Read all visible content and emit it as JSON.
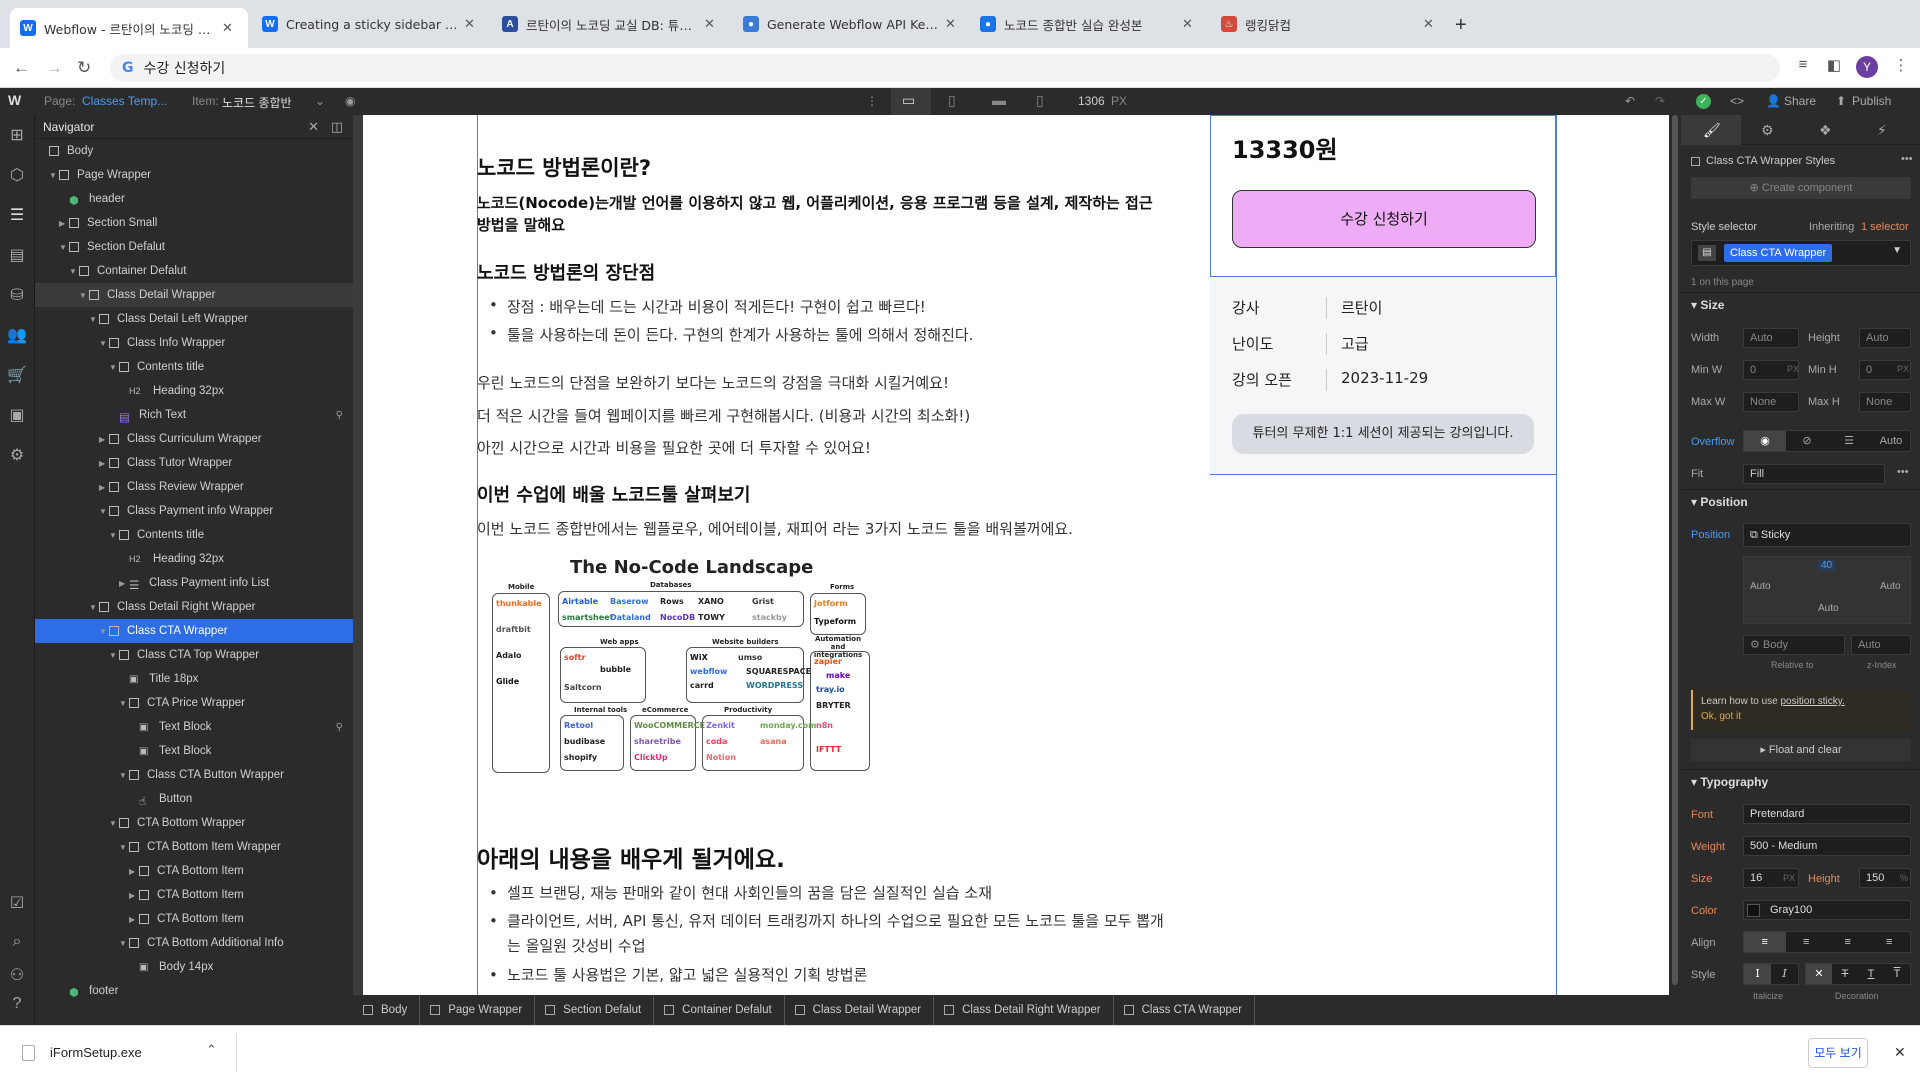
{
  "browser": {
    "tabs": [
      {
        "title": "Webflow - 르탄이의 노코딩 교실 C",
        "fav": "W",
        "color": "#146ef5",
        "active": true
      },
      {
        "title": "Creating a sticky sidebar | Web",
        "fav": "W",
        "color": "#146ef5",
        "active": false
      },
      {
        "title": "르탄이의 노코딩 교실 DB: 튜터 - Ai",
        "fav": "A",
        "color": "#2d4e9e",
        "active": false
      },
      {
        "title": "Generate Webflow API Key | N",
        "fav": "●",
        "color": "#3a7bd5",
        "active": false
      },
      {
        "title": "노코드 종합반 실습 완성본",
        "fav": "●",
        "color": "#1a73e8",
        "active": false
      },
      {
        "title": "랭킹닭컴",
        "fav": "♨",
        "color": "#d34a3a",
        "active": false
      }
    ],
    "new_tab": "+",
    "address": "수강 신청하기",
    "avatar": "Y",
    "nav_icons": [
      "back-icon",
      "forward-icon",
      "reload-icon"
    ]
  },
  "webflow_bar": {
    "logo": "W",
    "page_label": "Page:",
    "page_value": "Classes Temp...",
    "item_label": "Item:",
    "item_value": "노코드 종합반",
    "width_value": "1306",
    "width_unit": "PX",
    "share": "Share",
    "publish": "Publish"
  },
  "navigator": {
    "title": "Navigator",
    "rows": [
      {
        "label": "Body",
        "indent": 0,
        "arrow": "",
        "icon": "box"
      },
      {
        "label": "Page Wrapper",
        "indent": 1,
        "arrow": "▼",
        "icon": "box"
      },
      {
        "label": "header",
        "indent": 2,
        "arrow": "",
        "icon": "comp"
      },
      {
        "label": "Section Small",
        "indent": 2,
        "arrow": "▶",
        "icon": "sec"
      },
      {
        "label": "Section Defalut",
        "indent": 2,
        "arrow": "▼",
        "icon": "sec"
      },
      {
        "label": "Container Defalut",
        "indent": 3,
        "arrow": "▼",
        "icon": "cont"
      },
      {
        "label": "Class Detail Wrapper",
        "indent": 4,
        "arrow": "▼",
        "icon": "box",
        "hl": true
      },
      {
        "label": "Class Detail Left Wrapper",
        "indent": 5,
        "arrow": "▼",
        "icon": "box"
      },
      {
        "label": "Class Info Wrapper",
        "indent": 6,
        "arrow": "▼",
        "icon": "box"
      },
      {
        "label": "Contents title",
        "indent": 7,
        "arrow": "▼",
        "icon": "box"
      },
      {
        "label": "Heading 32px",
        "indent": 8,
        "arrow": "",
        "icon": "H2"
      },
      {
        "label": "Rich Text",
        "indent": 7,
        "arrow": "",
        "icon": "rt",
        "pin": true
      },
      {
        "label": "Class Curriculum Wrapper",
        "indent": 6,
        "arrow": "▶",
        "icon": "box"
      },
      {
        "label": "Class Tutor Wrapper",
        "indent": 6,
        "arrow": "▶",
        "icon": "box"
      },
      {
        "label": "Class Review Wrapper",
        "indent": 6,
        "arrow": "▶",
        "icon": "box"
      },
      {
        "label": "Class Payment info Wrapper",
        "indent": 6,
        "arrow": "▼",
        "icon": "box"
      },
      {
        "label": "Contents title",
        "indent": 7,
        "arrow": "▼",
        "icon": "box"
      },
      {
        "label": "Heading 32px",
        "indent": 8,
        "arrow": "",
        "icon": "H2"
      },
      {
        "label": "Class Payment info List",
        "indent": 8,
        "arrow": "▶",
        "icon": "list"
      },
      {
        "label": "Class Detail Right Wrapper",
        "indent": 5,
        "arrow": "▼",
        "icon": "box"
      },
      {
        "label": "Class CTA Wrapper",
        "indent": 6,
        "arrow": "▼",
        "icon": "box",
        "sel": true
      },
      {
        "label": "Class CTA Top Wrapper",
        "indent": 7,
        "arrow": "▼",
        "icon": "box"
      },
      {
        "label": "Title 18px",
        "indent": 8,
        "arrow": "",
        "icon": "T"
      },
      {
        "label": "CTA Price Wrapper",
        "indent": 8,
        "arrow": "▼",
        "icon": "box"
      },
      {
        "label": "Text Block",
        "indent": 9,
        "arrow": "",
        "icon": "T",
        "pin": true
      },
      {
        "label": "Text Block",
        "indent": 9,
        "arrow": "",
        "icon": "T"
      },
      {
        "label": "Class CTA Button Wrapper",
        "indent": 8,
        "arrow": "▼",
        "icon": "box"
      },
      {
        "label": "Button",
        "indent": 9,
        "arrow": "",
        "icon": "btn"
      },
      {
        "label": "CTA Bottom Wrapper",
        "indent": 7,
        "arrow": "▼",
        "icon": "box"
      },
      {
        "label": "CTA Bottom Item Wrapper",
        "indent": 8,
        "arrow": "▼",
        "icon": "box"
      },
      {
        "label": "CTA Bottom Item",
        "indent": 9,
        "arrow": "▶",
        "icon": "box"
      },
      {
        "label": "CTA Bottom Item",
        "indent": 9,
        "arrow": "▶",
        "icon": "box"
      },
      {
        "label": "CTA Bottom Item",
        "indent": 9,
        "arrow": "▶",
        "icon": "box"
      },
      {
        "label": "CTA Bottom Additional Info",
        "indent": 8,
        "arrow": "▼",
        "icon": "box"
      },
      {
        "label": "Body 14px",
        "indent": 9,
        "arrow": "",
        "icon": "T"
      },
      {
        "label": "footer",
        "indent": 2,
        "arrow": "",
        "icon": "comp"
      }
    ]
  },
  "page": {
    "h_method": "노코드 방법론이란?",
    "method_desc": "노코드(Nocode)는개발 언어를 이용하지 않고 웹, 어플리케이션, 응용 프로그램 등을 설계, 제작하는 접근 방법을 말해요",
    "h_proscons": "노코드 방법론의 장단점",
    "pros": "장점 : 배우는데 드는 시간과 비용이 적게든다! 구현이 쉽고 빠르다!",
    "cons": "툴을 사용하는데 돈이 든다. 구현의 한계가 사용하는 툴에 의해서 정해진다.",
    "p1": "우린 노코드의 단점을 보완하기 보다는 노코드의 강점을 극대화 시킬거예요!",
    "p2": "더 적은 시간을 들여 웹페이지를 빠르게 구현해봅시다. (비용과 시간의 최소화!)",
    "p3": "아낀 시간으로 시간과 비용을 필요한 곳에 더 투자할 수 있어요!",
    "h_tools": "이번 수업에 배울 노코드툴 살펴보기",
    "tools_desc": "이번 노코드 종합반에서는 웹플로우, 에어테이블, 재피어 라는 3가지 노코드 툴을 배워볼꺼에요.",
    "landscape_title": "The No-Code Landscape",
    "landscape_cats": [
      "Mobile",
      "Databases",
      "Forms",
      "Web apps",
      "Website builders",
      "Automation and integrations",
      "Internal tools",
      "eCommerce",
      "Productivity"
    ],
    "landscape_logos": [
      "thunkable",
      "draftbit",
      "Adalo",
      "Glide",
      "Airtable",
      "Baserow",
      "Rows",
      "XANO",
      "Grist",
      "smartsheet",
      "Dataland",
      "NocoDB",
      "TOWY",
      "stackby",
      "Jotform",
      "Typeform",
      "softr",
      "bubble",
      "Saltcorn",
      "WiX",
      "umso",
      "webflow",
      "carrd",
      "SQUARESPACE",
      "WORDPRESS",
      "zapier",
      "make",
      "tray.io",
      "BRYTER",
      "n8n",
      "IFTTT",
      "Retool",
      "budibase",
      "shopify",
      "WooCOMMERCE",
      "sharetribe",
      "ClickUp",
      "Zenkit",
      "monday.com",
      "coda",
      "asana",
      "Notion"
    ],
    "h_learn": "아래의 내용을 배우게 될거에요.",
    "learn": [
      "셀프 브랜딩, 재능 판매와 같이 현대 사회인들의 꿈을 담은 실질적인 실습 소재",
      "클라이언트, 서버, API 통신, 유저 데이터 트래킹까지 하나의 수업으로 필요한 모든 노코드  툴을 모두 뽑개는 올일원 갓성비 수업",
      "노코드 툴 사용법은 기본, 얇고 넓은 실용적인 기획 방법론"
    ],
    "price": "13330원",
    "cta_button": "수강 신청하기",
    "info": [
      {
        "k": "강사",
        "v": "르탄이"
      },
      {
        "k": "난이도",
        "v": "고급"
      },
      {
        "k": "강의 오픈",
        "v": "2023-11-29"
      }
    ],
    "info_note": "튜터의 무제한 1:1 세션이 제공되는 강의입니다."
  },
  "breadcrumb": [
    "Body",
    "Page Wrapper",
    "Section Defalut",
    "Container Defalut",
    "Class Detail Wrapper",
    "Class Detail Right Wrapper",
    "Class CTA Wrapper"
  ],
  "style_panel": {
    "styles_title": "Class CTA Wrapper Styles",
    "create_component": "Create component",
    "style_selector": "Style selector",
    "inheriting": "Inheriting",
    "inheriting_count": "1 selector",
    "class_chip": "Class CTA Wrapper",
    "on_page": "1 on this page",
    "size": {
      "title": "Size",
      "width": "Width",
      "height": "Height",
      "minw": "Min W",
      "minh": "Min H",
      "maxw": "Max W",
      "maxh": "Max H",
      "auto": "Auto",
      "zero": "0",
      "none": "None",
      "px": "PX"
    },
    "overflow": "Overflow",
    "overflow_auto": "Auto",
    "fit": "Fit",
    "fit_value": "Fill",
    "position": {
      "title": "Position",
      "label": "Position",
      "value": "Sticky",
      "top": "40",
      "auto": "Auto",
      "body": "Body",
      "relative_to": "Relative to",
      "zindex": "z-Index"
    },
    "learn_text": "Learn how to use ",
    "learn_link": "position sticky.",
    "got_it": "Ok, got it",
    "float_clear": "Float and clear",
    "typography": {
      "title": "Typography",
      "font_label": "Font",
      "font": "Pretendard",
      "weight_label": "Weight",
      "weight": "500 - Medium",
      "size_label": "Size",
      "size": "16",
      "px": "PX",
      "height_label": "Height",
      "height": "150",
      "pct": "%",
      "color_label": "Color",
      "color": "Gray100",
      "align_label": "Align",
      "style_label": "Style",
      "italicize": "Italicize",
      "decoration": "Decoration"
    }
  },
  "download": {
    "file": "iFormSetup.exe",
    "show_all": "모두 보기"
  }
}
